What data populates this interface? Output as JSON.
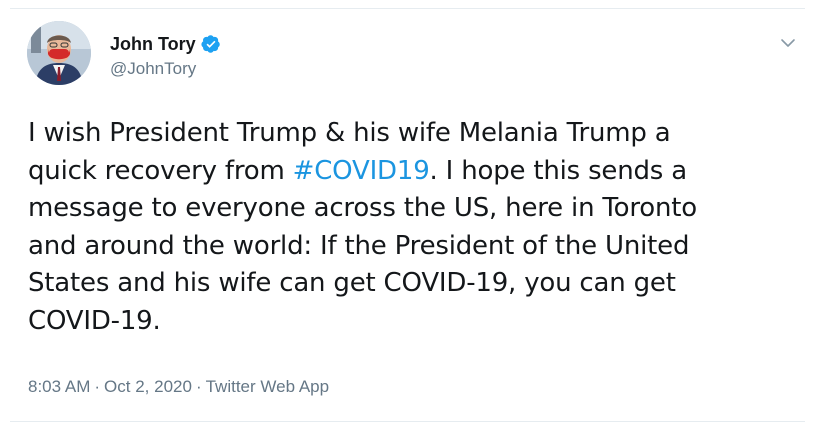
{
  "author": {
    "display_name": "John Tory",
    "handle": "@JohnTory",
    "verified": true,
    "avatar_icon": "profile-photo-masked-man",
    "verified_icon": "verified-badge-icon",
    "verified_color": "#1da1f2"
  },
  "menu": {
    "icon": "chevron-down-icon"
  },
  "tweet": {
    "lines": [
      {
        "segments": [
          {
            "text": "I wish President Trump & his wife Melania Trump a",
            "link": false
          }
        ]
      },
      {
        "segments": [
          {
            "text": "quick recovery from ",
            "link": false
          },
          {
            "text": "#COVID19",
            "link": true
          },
          {
            "text": ". I hope this sends a",
            "link": false
          }
        ]
      },
      {
        "segments": [
          {
            "text": "message to everyone across the US, here in Toronto",
            "link": false
          }
        ]
      },
      {
        "segments": [
          {
            "text": "and around the world: If the President of the United",
            "link": false
          }
        ]
      },
      {
        "segments": [
          {
            "text": "States and his wife can get COVID-19, you can get",
            "link": false
          }
        ]
      },
      {
        "segments": [
          {
            "text": "COVID-19.",
            "link": false
          }
        ]
      }
    ],
    "hashtag_color": "#1b95e0"
  },
  "meta": {
    "time": "8:03 AM",
    "date": "Oct 2, 2020",
    "source": "Twitter Web App",
    "separator": "·"
  }
}
